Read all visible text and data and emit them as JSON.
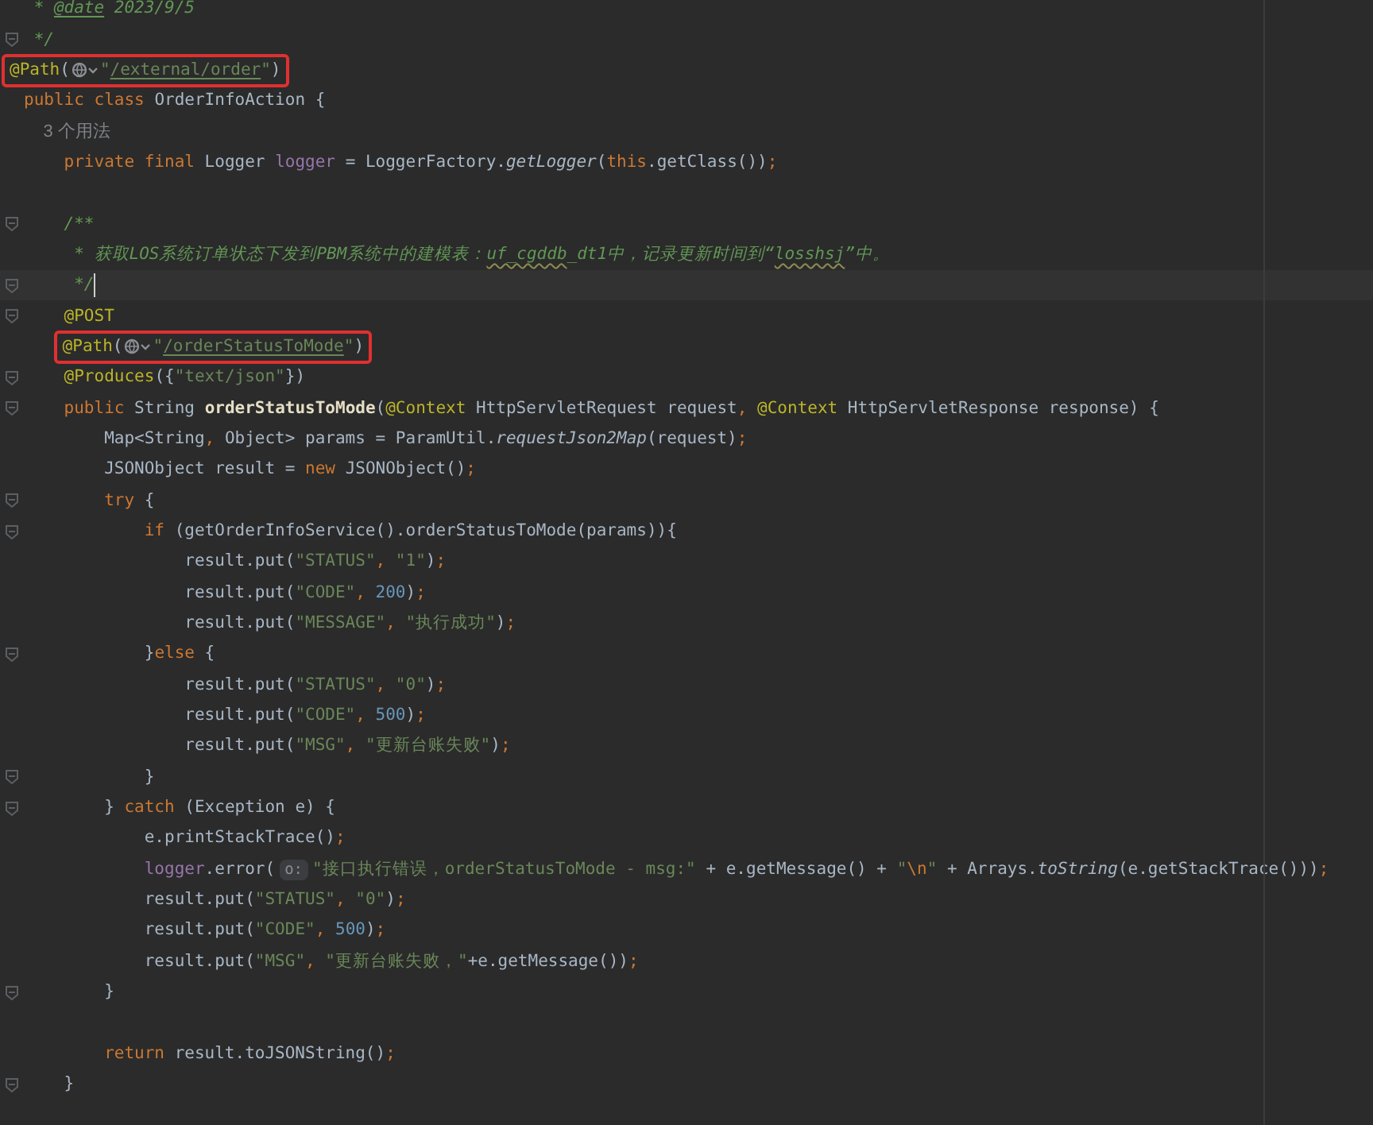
{
  "editor": {
    "lines": [
      {
        "fold": false,
        "current": false,
        "boxed": false,
        "tokens": [
          {
            "kind": "comment",
            "text": " * "
          },
          {
            "kind": "doc_tag",
            "text": "@date"
          },
          {
            "kind": "comment",
            "text": " 2023/9/5"
          }
        ]
      },
      {
        "fold": true,
        "current": false,
        "boxed": false,
        "tokens": [
          {
            "kind": "comment",
            "text": " */"
          }
        ]
      },
      {
        "fold": false,
        "current": false,
        "boxed": true,
        "tokens": [
          {
            "kind": "annotation",
            "text": "@Path"
          },
          {
            "kind": "plain",
            "text": "("
          },
          {
            "kind": "globe"
          },
          {
            "kind": "string",
            "text": "\""
          },
          {
            "kind": "path",
            "text": "/external/order"
          },
          {
            "kind": "string",
            "text": "\""
          },
          {
            "kind": "plain",
            "text": ")"
          }
        ]
      },
      {
        "fold": false,
        "current": false,
        "boxed": false,
        "tokens": [
          {
            "kind": "keyword",
            "text": "public class "
          },
          {
            "kind": "plain",
            "text": "OrderInfoAction {"
          }
        ]
      },
      {
        "fold": false,
        "current": false,
        "boxed": false,
        "tokens": [
          {
            "kind": "hint",
            "text": "    3 个用法"
          }
        ]
      },
      {
        "fold": false,
        "current": false,
        "boxed": false,
        "tokens": [
          {
            "kind": "keyword",
            "text": "    private final "
          },
          {
            "kind": "plain",
            "text": "Logger "
          },
          {
            "kind": "field",
            "text": "logger"
          },
          {
            "kind": "plain",
            "text": " = LoggerFactory."
          },
          {
            "kind": "static",
            "text": "getLogger"
          },
          {
            "kind": "plain",
            "text": "("
          },
          {
            "kind": "keyword",
            "text": "this"
          },
          {
            "kind": "plain",
            "text": ".getClass())"
          },
          {
            "kind": "punct",
            "text": ";"
          }
        ]
      },
      {
        "fold": false,
        "current": false,
        "boxed": false
      },
      {
        "fold": true,
        "current": false,
        "boxed": false,
        "tokens": [
          {
            "kind": "comment",
            "text": "    /**"
          }
        ]
      },
      {
        "fold": false,
        "current": false,
        "boxed": false,
        "tokens": [
          {
            "kind": "comment",
            "text": "     * 获取LOS系统订单状态下发到PBM系统中的建模表："
          },
          {
            "kind": "typo",
            "text": "uf_cgddb"
          },
          {
            "kind": "comment",
            "text": "_dt1中，记录更新时间到“"
          },
          {
            "kind": "typo",
            "text": "losshsj"
          },
          {
            "kind": "comment",
            "text": "”中。"
          }
        ]
      },
      {
        "fold": true,
        "current": true,
        "boxed": false,
        "tokens": [
          {
            "kind": "comment",
            "text": "     */"
          }
        ]
      },
      {
        "fold": true,
        "current": false,
        "boxed": false,
        "tokens": [
          {
            "kind": "annotation",
            "text": "    @POST"
          }
        ]
      },
      {
        "fold": false,
        "current": false,
        "boxed": true,
        "tokens": [
          {
            "kind": "annotation",
            "text": "@Path"
          },
          {
            "kind": "plain",
            "text": "("
          },
          {
            "kind": "globe"
          },
          {
            "kind": "string",
            "text": "\""
          },
          {
            "kind": "path",
            "text": "/orderStatusToMode"
          },
          {
            "kind": "string",
            "text": "\""
          },
          {
            "kind": "plain",
            "text": ")"
          }
        ]
      },
      {
        "fold": true,
        "current": false,
        "boxed": false,
        "tokens": [
          {
            "kind": "annotation",
            "text": "    @Produces"
          },
          {
            "kind": "plain",
            "text": "({"
          },
          {
            "kind": "string",
            "text": "\"text/json\""
          },
          {
            "kind": "plain",
            "text": "})"
          }
        ]
      },
      {
        "fold": true,
        "current": false,
        "boxed": false,
        "tokens": [
          {
            "kind": "keyword",
            "text": "    public "
          },
          {
            "kind": "plain",
            "text": "String "
          },
          {
            "kind": "decl",
            "text": "orderStatusToMode"
          },
          {
            "kind": "plain",
            "text": "("
          },
          {
            "kind": "annotation",
            "text": "@Context"
          },
          {
            "kind": "plain",
            "text": " HttpServletRequest request"
          },
          {
            "kind": "punct",
            "text": ", "
          },
          {
            "kind": "annotation",
            "text": "@Context"
          },
          {
            "kind": "plain",
            "text": " HttpServletResponse response) {"
          }
        ]
      },
      {
        "fold": false,
        "current": false,
        "boxed": false,
        "tokens": [
          {
            "kind": "plain",
            "text": "        Map<String"
          },
          {
            "kind": "punct",
            "text": ", "
          },
          {
            "kind": "plain",
            "text": "Object> params = ParamUtil."
          },
          {
            "kind": "static",
            "text": "requestJson2Map"
          },
          {
            "kind": "plain",
            "text": "(request)"
          },
          {
            "kind": "punct",
            "text": ";"
          }
        ]
      },
      {
        "fold": false,
        "current": false,
        "boxed": false,
        "tokens": [
          {
            "kind": "plain",
            "text": "        JSONObject result = "
          },
          {
            "kind": "keyword",
            "text": "new "
          },
          {
            "kind": "plain",
            "text": "JSONObject()"
          },
          {
            "kind": "punct",
            "text": ";"
          }
        ]
      },
      {
        "fold": true,
        "current": false,
        "boxed": false,
        "tokens": [
          {
            "kind": "keyword",
            "text": "        try "
          },
          {
            "kind": "plain",
            "text": "{"
          }
        ]
      },
      {
        "fold": true,
        "current": false,
        "boxed": false,
        "tokens": [
          {
            "kind": "keyword",
            "text": "            if "
          },
          {
            "kind": "plain",
            "text": "(getOrderInfoService().orderStatusToMode(params)){"
          }
        ]
      },
      {
        "fold": false,
        "current": false,
        "boxed": false,
        "tokens": [
          {
            "kind": "plain",
            "text": "                result.put("
          },
          {
            "kind": "string",
            "text": "\"STATUS\""
          },
          {
            "kind": "punct",
            "text": ", "
          },
          {
            "kind": "string",
            "text": "\"1\""
          },
          {
            "kind": "plain",
            "text": ")"
          },
          {
            "kind": "punct",
            "text": ";"
          }
        ]
      },
      {
        "fold": false,
        "current": false,
        "boxed": false,
        "tokens": [
          {
            "kind": "plain",
            "text": "                result.put("
          },
          {
            "kind": "string",
            "text": "\"CODE\""
          },
          {
            "kind": "punct",
            "text": ", "
          },
          {
            "kind": "number",
            "text": "200"
          },
          {
            "kind": "plain",
            "text": ")"
          },
          {
            "kind": "punct",
            "text": ";"
          }
        ]
      },
      {
        "fold": false,
        "current": false,
        "boxed": false,
        "tokens": [
          {
            "kind": "plain",
            "text": "                result.put("
          },
          {
            "kind": "string",
            "text": "\"MESSAGE\""
          },
          {
            "kind": "punct",
            "text": ", "
          },
          {
            "kind": "string",
            "text": "\"执行成功\""
          },
          {
            "kind": "plain",
            "text": ")"
          },
          {
            "kind": "punct",
            "text": ";"
          }
        ]
      },
      {
        "fold": true,
        "current": false,
        "boxed": false,
        "tokens": [
          {
            "kind": "plain",
            "text": "            }"
          },
          {
            "kind": "keyword",
            "text": "else "
          },
          {
            "kind": "plain",
            "text": "{"
          }
        ]
      },
      {
        "fold": false,
        "current": false,
        "boxed": false,
        "tokens": [
          {
            "kind": "plain",
            "text": "                result.put("
          },
          {
            "kind": "string",
            "text": "\"STATUS\""
          },
          {
            "kind": "punct",
            "text": ", "
          },
          {
            "kind": "string",
            "text": "\"0\""
          },
          {
            "kind": "plain",
            "text": ")"
          },
          {
            "kind": "punct",
            "text": ";"
          }
        ]
      },
      {
        "fold": false,
        "current": false,
        "boxed": false,
        "tokens": [
          {
            "kind": "plain",
            "text": "                result.put("
          },
          {
            "kind": "string",
            "text": "\"CODE\""
          },
          {
            "kind": "punct",
            "text": ", "
          },
          {
            "kind": "number",
            "text": "500"
          },
          {
            "kind": "plain",
            "text": ")"
          },
          {
            "kind": "punct",
            "text": ";"
          }
        ]
      },
      {
        "fold": false,
        "current": false,
        "boxed": false,
        "tokens": [
          {
            "kind": "plain",
            "text": "                result.put("
          },
          {
            "kind": "string",
            "text": "\"MSG\""
          },
          {
            "kind": "punct",
            "text": ", "
          },
          {
            "kind": "string",
            "text": "\"更新台账失败\""
          },
          {
            "kind": "plain",
            "text": ")"
          },
          {
            "kind": "punct",
            "text": ";"
          }
        ]
      },
      {
        "fold": true,
        "current": false,
        "boxed": false,
        "tokens": [
          {
            "kind": "plain",
            "text": "            }"
          }
        ]
      },
      {
        "fold": true,
        "current": false,
        "boxed": false,
        "tokens": [
          {
            "kind": "plain",
            "text": "        } "
          },
          {
            "kind": "keyword",
            "text": "catch "
          },
          {
            "kind": "plain",
            "text": "(Exception e) {"
          }
        ]
      },
      {
        "fold": false,
        "current": false,
        "boxed": false,
        "tokens": [
          {
            "kind": "plain",
            "text": "            e.printStackTrace()"
          },
          {
            "kind": "punct",
            "text": ";"
          }
        ]
      },
      {
        "fold": false,
        "current": false,
        "boxed": false,
        "tokens": [
          {
            "kind": "field",
            "text": "            logger"
          },
          {
            "kind": "plain",
            "text": ".error("
          },
          {
            "kind": "param_hint",
            "text": "o:"
          },
          {
            "kind": "string",
            "text": "\"接口执行错误，orderStatusToMode - msg:\""
          },
          {
            "kind": "plain",
            "text": " + e.getMessage() + "
          },
          {
            "kind": "string",
            "text": "\""
          },
          {
            "kind": "escape",
            "text": "\\n"
          },
          {
            "kind": "string",
            "text": "\""
          },
          {
            "kind": "plain",
            "text": " + Arrays."
          },
          {
            "kind": "static",
            "text": "toString"
          },
          {
            "kind": "plain",
            "text": "(e.getStackTrace()))"
          },
          {
            "kind": "punct",
            "text": ";"
          }
        ]
      },
      {
        "fold": false,
        "current": false,
        "boxed": false,
        "tokens": [
          {
            "kind": "plain",
            "text": "            result.put("
          },
          {
            "kind": "string",
            "text": "\"STATUS\""
          },
          {
            "kind": "punct",
            "text": ", "
          },
          {
            "kind": "string",
            "text": "\"0\""
          },
          {
            "kind": "plain",
            "text": ")"
          },
          {
            "kind": "punct",
            "text": ";"
          }
        ]
      },
      {
        "fold": false,
        "current": false,
        "boxed": false,
        "tokens": [
          {
            "kind": "plain",
            "text": "            result.put("
          },
          {
            "kind": "string",
            "text": "\"CODE\""
          },
          {
            "kind": "punct",
            "text": ", "
          },
          {
            "kind": "number",
            "text": "500"
          },
          {
            "kind": "plain",
            "text": ")"
          },
          {
            "kind": "punct",
            "text": ";"
          }
        ]
      },
      {
        "fold": false,
        "current": false,
        "boxed": false,
        "tokens": [
          {
            "kind": "plain",
            "text": "            result.put("
          },
          {
            "kind": "string",
            "text": "\"MSG\""
          },
          {
            "kind": "punct",
            "text": ", "
          },
          {
            "kind": "string",
            "text": "\"更新台账失败，\""
          },
          {
            "kind": "plain",
            "text": "+e.getMessage())"
          },
          {
            "kind": "punct",
            "text": ";"
          }
        ]
      },
      {
        "fold": true,
        "current": false,
        "boxed": false,
        "tokens": [
          {
            "kind": "plain",
            "text": "        }"
          }
        ]
      },
      {
        "fold": false,
        "current": false,
        "boxed": false
      },
      {
        "fold": false,
        "current": false,
        "boxed": false,
        "tokens": [
          {
            "kind": "keyword",
            "text": "        return "
          },
          {
            "kind": "plain",
            "text": "result.toJSONString()"
          },
          {
            "kind": "punct",
            "text": ";"
          }
        ]
      },
      {
        "fold": true,
        "current": false,
        "boxed": false,
        "tokens": [
          {
            "kind": "plain",
            "text": "    }"
          }
        ]
      }
    ]
  }
}
